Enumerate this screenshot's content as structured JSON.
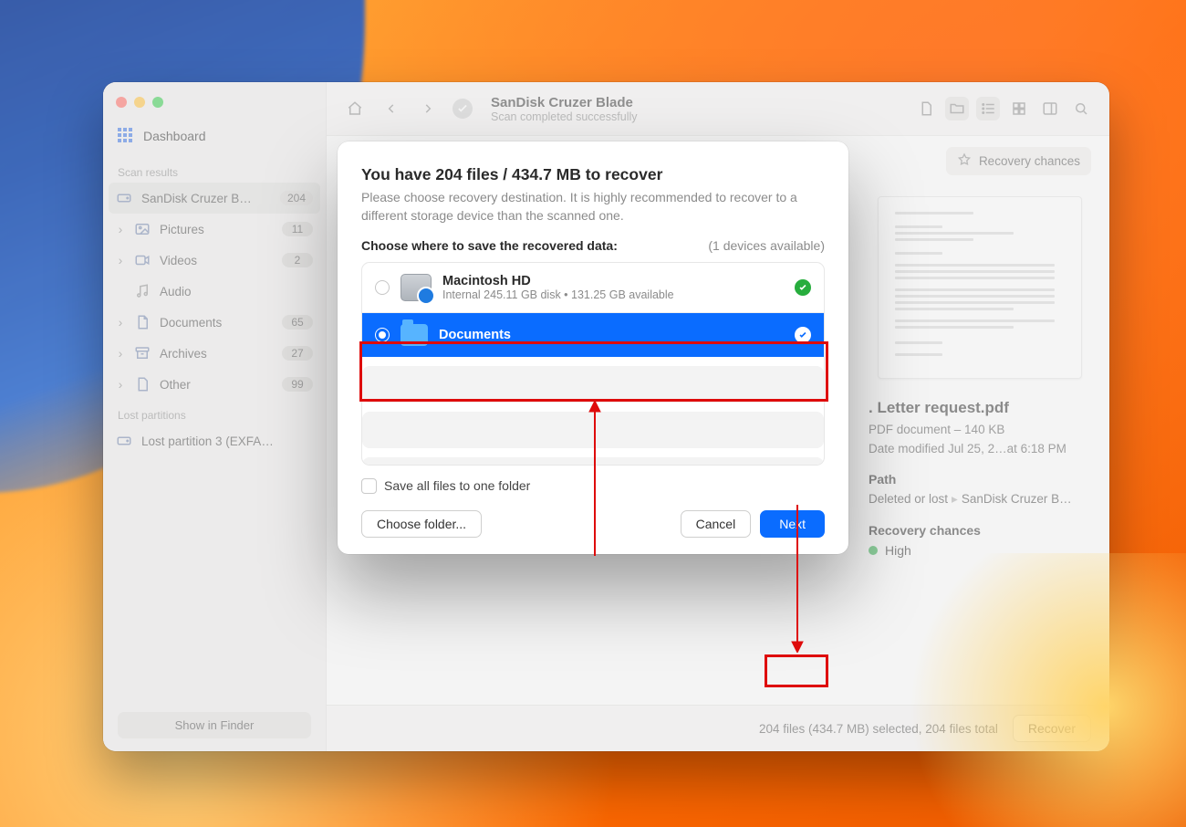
{
  "window": {
    "title": "SanDisk Cruzer Blade",
    "subtitle": "Scan completed successfully"
  },
  "sidebar": {
    "dashboard_label": "Dashboard",
    "section_scan": "Scan results",
    "items": [
      {
        "label": "SanDisk Cruzer B…",
        "badge": "204"
      },
      {
        "label": "Pictures",
        "badge": "11"
      },
      {
        "label": "Videos",
        "badge": "2"
      },
      {
        "label": "Audio",
        "badge": ""
      },
      {
        "label": "Documents",
        "badge": "65"
      },
      {
        "label": "Archives",
        "badge": "27"
      },
      {
        "label": "Other",
        "badge": "99"
      }
    ],
    "section_lost": "Lost partitions",
    "lost_item": "Lost partition 3 (EXFA…",
    "show_in_finder": "Show in Finder"
  },
  "chip": {
    "recovery_chances": "Recovery chances"
  },
  "preview": {
    "filename": ". Letter request.pdf",
    "kind": "PDF document – 140 KB",
    "modified": "Date modified  Jul 25, 2…at 6:18 PM",
    "path_heading": "Path",
    "path_1": "Deleted or lost",
    "path_2": "SanDisk Cruzer B…",
    "rc_heading": "Recovery chances",
    "rc_value": "High"
  },
  "footer": {
    "stats": "204 files (434.7 MB) selected, 204 files total",
    "recover": "Recover"
  },
  "modal": {
    "heading": "You have 204 files / 434.7 MB to recover",
    "subtext": "Please choose recovery destination. It is highly recommended to recover to a different storage device than the scanned one.",
    "choose_label": "Choose where to save the recovered data:",
    "devices_count": "(1 devices available)",
    "dest": [
      {
        "name": "Macintosh HD",
        "meta": "Internal 245.11 GB disk • 131.25 GB available"
      },
      {
        "name": "Documents",
        "meta": ""
      }
    ],
    "save_one": "Save all files to one folder",
    "choose_folder": "Choose folder...",
    "cancel": "Cancel",
    "next": "Next"
  }
}
